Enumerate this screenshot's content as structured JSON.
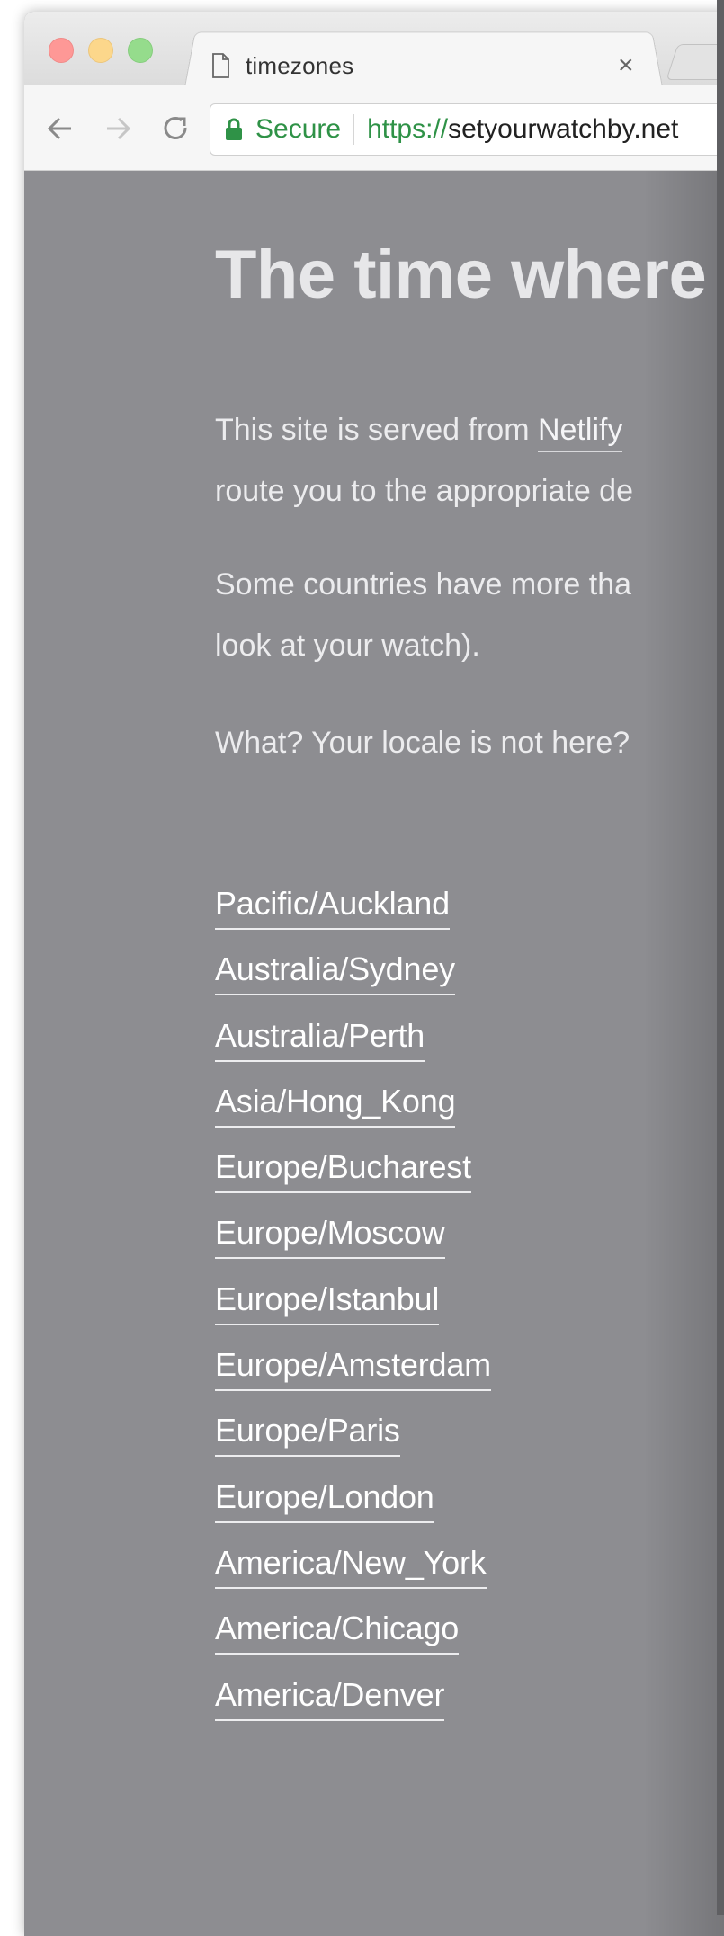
{
  "tab": {
    "title": "timezones",
    "close": "×"
  },
  "address_bar": {
    "secure_label": "Secure",
    "scheme": "https://",
    "host": "setyourwatchby.net"
  },
  "page": {
    "heading": "The time where",
    "paragraphs": [
      {
        "text_before": "This site is served from ",
        "link": "Netlify",
        "line2": "route you to the appropriate de"
      },
      {
        "line1": "Some countries have more tha",
        "line2": "look at your watch)."
      },
      {
        "line1": "What? Your locale is not here?"
      }
    ],
    "timezones": [
      "Pacific/Auckland",
      "Australia/Sydney",
      "Australia/Perth",
      "Asia/Hong_Kong",
      "Europe/Bucharest",
      "Europe/Moscow",
      "Europe/Istanbul",
      "Europe/Amsterdam",
      "Europe/Paris",
      "Europe/London",
      "America/New_York",
      "America/Chicago",
      "America/Denver"
    ]
  },
  "colors": {
    "page_background": "#8d8d91",
    "secure_green": "#2f9247",
    "traffic_close": "#fe9896",
    "traffic_minimize": "#fcd78b",
    "traffic_maximize": "#95dc8c"
  }
}
